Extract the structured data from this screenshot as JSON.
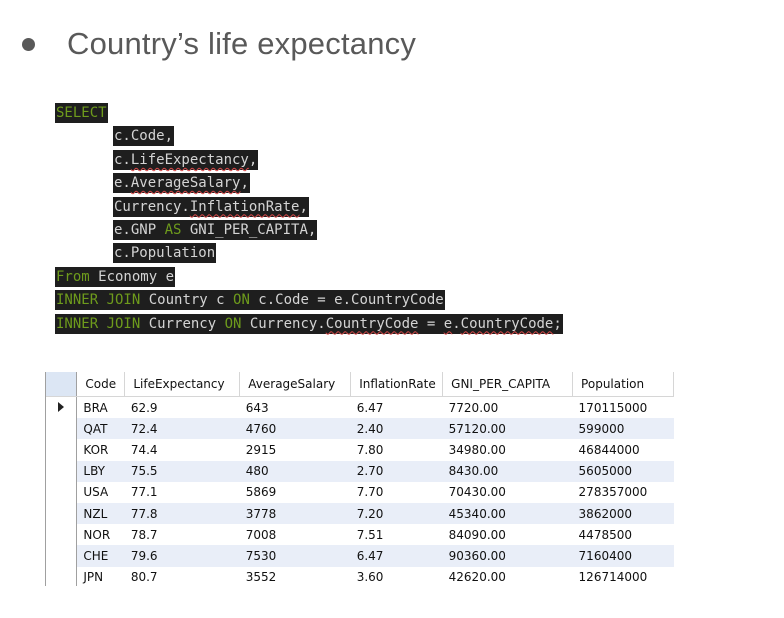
{
  "heading": {
    "bullet": "●",
    "title": "Country’s life expectancy"
  },
  "sql": {
    "lines": [
      {
        "indent": false,
        "segments": [
          {
            "t": "SELECT",
            "kw": true
          }
        ]
      },
      {
        "indent": true,
        "segments": [
          {
            "t": "c.Code,"
          }
        ]
      },
      {
        "indent": true,
        "segments": [
          {
            "t": "c."
          },
          {
            "t": "LifeExpectancy",
            "squig": true
          },
          {
            "t": ","
          }
        ]
      },
      {
        "indent": true,
        "segments": [
          {
            "t": "e."
          },
          {
            "t": "AverageSalary",
            "squig": true
          },
          {
            "t": ","
          }
        ]
      },
      {
        "indent": true,
        "segments": [
          {
            "t": "Currency."
          },
          {
            "t": "InflationRate",
            "squig": true
          },
          {
            "t": ","
          }
        ]
      },
      {
        "indent": true,
        "segments": [
          {
            "t": "e.GNP "
          },
          {
            "t": "AS",
            "kw": true
          },
          {
            "t": " GNI_PER_CAPITA,"
          }
        ]
      },
      {
        "indent": true,
        "segments": [
          {
            "t": "c.Population"
          }
        ]
      },
      {
        "indent": false,
        "segments": [
          {
            "t": "From",
            "kw": true
          },
          {
            "t": " Economy e"
          }
        ]
      },
      {
        "indent": false,
        "segments": [
          {
            "t": "INNER JOIN",
            "kw": true
          },
          {
            "t": " Country c "
          },
          {
            "t": "ON",
            "kw": true
          },
          {
            "t": " c.Code = e.CountryCode"
          }
        ]
      },
      {
        "indent": false,
        "segments": [
          {
            "t": "INNER JOIN",
            "kw": true
          },
          {
            "t": " Currency "
          },
          {
            "t": "ON",
            "kw": true
          },
          {
            "t": " Currency."
          },
          {
            "t": "CountryCode",
            "squig": true
          },
          {
            "t": " = "
          },
          {
            "t": "e",
            "squig": true
          },
          {
            "t": "."
          },
          {
            "t": "CountryCode",
            "squig": true
          },
          {
            "t": ";"
          }
        ]
      }
    ]
  },
  "results": {
    "columns": [
      "Code",
      "LifeExpectancy",
      "AverageSalary",
      "InflationRate",
      "GNI_PER_CAPITA",
      "Population"
    ],
    "current_row": 0,
    "rows": [
      [
        "BRA",
        "62.9",
        "643",
        "6.47",
        "7720.00",
        "170115000"
      ],
      [
        "QAT",
        "72.4",
        "4760",
        "2.40",
        "57120.00",
        "599000"
      ],
      [
        "KOR",
        "74.4",
        "2915",
        "7.80",
        "34980.00",
        "46844000"
      ],
      [
        "LBY",
        "75.5",
        "480",
        "2.70",
        "8430.00",
        "5605000"
      ],
      [
        "USA",
        "77.1",
        "5869",
        "7.70",
        "70430.00",
        "278357000"
      ],
      [
        "NZL",
        "77.8",
        "3778",
        "7.20",
        "45340.00",
        "3862000"
      ],
      [
        "NOR",
        "78.7",
        "7008",
        "7.51",
        "84090.00",
        "4478500"
      ],
      [
        "CHE",
        "79.6",
        "7530",
        "6.47",
        "90360.00",
        "7160400"
      ],
      [
        "JPN",
        "80.7",
        "3552",
        "3.60",
        "42620.00",
        "126714000"
      ]
    ]
  }
}
